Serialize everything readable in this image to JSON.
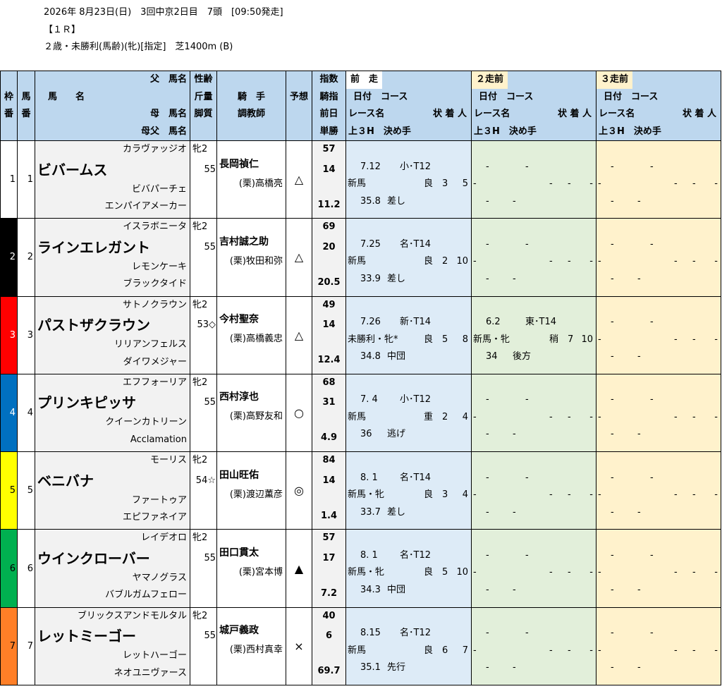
{
  "race": {
    "line1": "2026年 8月23日(日)　3回中京2日目　7頭　[09:50発走]",
    "line2": "【１Ｒ】",
    "line3": "２歳・未勝利(馬齢)(牝)[指定]　芝1400m (B)"
  },
  "header": {
    "waku": [
      "枠",
      "番"
    ],
    "uma": [
      "馬",
      "番"
    ],
    "name_col": [
      "父　馬名",
      "馬　　名",
      "母　馬名",
      "母父　馬名"
    ],
    "sei_col": [
      "性齢",
      "斤量",
      "脚質"
    ],
    "jockey_col": [
      "騎　手",
      "調教師"
    ],
    "yoso": "予想",
    "idx_col": [
      "指数",
      "騎指",
      "前日",
      "単勝"
    ],
    "prev1": {
      "title": "前　走",
      "date": "日付　コース",
      "race": "レース名",
      "stat": "状 着 人",
      "fin": "上３H　決め手"
    },
    "prev2": {
      "title": "２走前",
      "date": "日付　コース",
      "race": "レース名",
      "stat": "状 着 人",
      "fin": "上３H　決め手"
    },
    "prev3": {
      "title": "３走前",
      "date": "日付　コース",
      "race": "レース名",
      "stat": "状 着 人",
      "fin": "上３H　決め手"
    }
  },
  "colors": {
    "waku": [
      "#ffffff",
      "#000000",
      "#ff0000",
      "#0070c0",
      "#ffff00",
      "#00b050",
      "#ff7f27"
    ]
  },
  "horses": [
    {
      "waku": "1",
      "num": "1",
      "sire": "カラヴァッジオ",
      "name": "ビバームス",
      "dam": "ビバパーチェ",
      "damsire": "エンパイアメーカー",
      "sex": "牝2",
      "kinryo": "55",
      "jockey": "長岡禎仁",
      "trainer": "(栗)高橋亮",
      "yoso": "△",
      "idx": "57",
      "kishi": "14",
      "zenjitsu": "",
      "tansho": "11.2",
      "p1": {
        "date": "7.12",
        "course": "小･T12",
        "race": "新馬",
        "cond": "良",
        "place": "3",
        "pop": "5",
        "last3": "35.8",
        "kime": "差し"
      },
      "p2": {
        "date": "-",
        "course": "-",
        "race": "-",
        "cond": "-",
        "place": "-",
        "pop": "-",
        "last3": "-",
        "kime": "-"
      },
      "p3": {
        "date": "-",
        "course": "-",
        "race": "-",
        "cond": "-",
        "place": "-",
        "pop": "-",
        "last3": "-",
        "kime": "-"
      }
    },
    {
      "waku": "2",
      "num": "2",
      "sire": "イスラボニータ",
      "name": "ラインエレガント",
      "dam": "レモンケーキ",
      "damsire": "ブラックタイド",
      "sex": "牝2",
      "kinryo": "55",
      "jockey": "吉村誠之助",
      "trainer": "(栗)牧田和弥",
      "yoso": "△",
      "idx": "69",
      "kishi": "20",
      "zenjitsu": "",
      "tansho": "20.5",
      "p1": {
        "date": "7.25",
        "course": "名･T14",
        "race": "新馬",
        "cond": "良",
        "place": "2",
        "pop": "10",
        "last3": "33.9",
        "kime": "差し"
      },
      "p2": {
        "date": "-",
        "course": "-",
        "race": "-",
        "cond": "-",
        "place": "-",
        "pop": "-",
        "last3": "-",
        "kime": "-"
      },
      "p3": {
        "date": "-",
        "course": "-",
        "race": "-",
        "cond": "-",
        "place": "-",
        "pop": "-",
        "last3": "-",
        "kime": "-"
      }
    },
    {
      "waku": "3",
      "num": "3",
      "sire": "サトノクラウン",
      "name": "パストザクラウン",
      "dam": "リリアンフェルス",
      "damsire": "ダイワメジャー",
      "sex": "牝2",
      "kinryo": "53◇",
      "jockey": "今村聖奈",
      "trainer": "(栗)高橋義忠",
      "yoso": "△",
      "idx": "49",
      "kishi": "14",
      "zenjitsu": "",
      "tansho": "12.4",
      "p1": {
        "date": "7.26",
        "course": "新･T14",
        "race": "未勝利・牝*",
        "cond": "良",
        "place": "5",
        "pop": "8",
        "last3": "34.8",
        "kime": "中団"
      },
      "p2": {
        "date": "6.2",
        "course": "東･T14",
        "race": "新馬・牝",
        "cond": "稍",
        "place": "7",
        "pop": "10",
        "last3": "34",
        "kime": "後方"
      },
      "p3": {
        "date": "-",
        "course": "-",
        "race": "-",
        "cond": "-",
        "place": "-",
        "pop": "-",
        "last3": "-",
        "kime": "-"
      }
    },
    {
      "waku": "4",
      "num": "4",
      "sire": "エフフォーリア",
      "name": "プリンキピッサ",
      "dam": "クイーンカトリーン",
      "damsire": "Acclamation",
      "sex": "牝2",
      "kinryo": "55",
      "jockey": "西村淳也",
      "trainer": "(栗)高野友和",
      "yoso": "○",
      "idx": "68",
      "kishi": "31",
      "zenjitsu": "",
      "tansho": "4.9",
      "p1": {
        "date": "7. 4",
        "course": "小･T12",
        "race": "新馬",
        "cond": "重",
        "place": "2",
        "pop": "4",
        "last3": "36",
        "kime": "逃げ"
      },
      "p2": {
        "date": "-",
        "course": "-",
        "race": "-",
        "cond": "-",
        "place": "-",
        "pop": "-",
        "last3": "-",
        "kime": "-"
      },
      "p3": {
        "date": "-",
        "course": "-",
        "race": "-",
        "cond": "-",
        "place": "-",
        "pop": "-",
        "last3": "-",
        "kime": "-"
      }
    },
    {
      "waku": "5",
      "num": "5",
      "sire": "モーリス",
      "name": "ベニバナ",
      "dam": "ファートゥア",
      "damsire": "エピファネイア",
      "sex": "牝2",
      "kinryo": "54☆",
      "jockey": "田山旺佑",
      "trainer": "(栗)渡辺薫彦",
      "yoso": "◎",
      "idx": "84",
      "kishi": "14",
      "zenjitsu": "",
      "tansho": "1.4",
      "p1": {
        "date": "8. 1",
        "course": "名･T14",
        "race": "新馬・牝",
        "cond": "良",
        "place": "3",
        "pop": "4",
        "last3": "33.7",
        "kime": "差し"
      },
      "p2": {
        "date": "-",
        "course": "-",
        "race": "-",
        "cond": "-",
        "place": "-",
        "pop": "-",
        "last3": "-",
        "kime": "-"
      },
      "p3": {
        "date": "-",
        "course": "-",
        "race": "-",
        "cond": "-",
        "place": "-",
        "pop": "-",
        "last3": "-",
        "kime": "-"
      }
    },
    {
      "waku": "6",
      "num": "6",
      "sire": "レイデオロ",
      "name": "ウインクローバー",
      "dam": "ヤマノグラス",
      "damsire": "バブルガムフェロー",
      "sex": "牝2",
      "kinryo": "55",
      "jockey": "田口貫太",
      "trainer": "(栗)宮本博",
      "yoso": "▲",
      "idx": "57",
      "kishi": "17",
      "zenjitsu": "",
      "tansho": "7.2",
      "p1": {
        "date": "8. 1",
        "course": "名･T12",
        "race": "新馬・牝",
        "cond": "良",
        "place": "5",
        "pop": "10",
        "last3": "34.3",
        "kime": "中団"
      },
      "p2": {
        "date": "-",
        "course": "-",
        "race": "-",
        "cond": "-",
        "place": "-",
        "pop": "-",
        "last3": "-",
        "kime": "-"
      },
      "p3": {
        "date": "-",
        "course": "-",
        "race": "-",
        "cond": "-",
        "place": "-",
        "pop": "-",
        "last3": "-",
        "kime": "-"
      }
    },
    {
      "waku": "7",
      "num": "7",
      "sire": "ブリックスアンドモルタル",
      "name": "レットミーゴー",
      "dam": "レットハーゴー",
      "damsire": "ネオユニヴァース",
      "sex": "牝2",
      "kinryo": "55",
      "jockey": "城戸義政",
      "trainer": "(栗)西村真幸",
      "yoso": "×",
      "idx": "40",
      "kishi": "6",
      "zenjitsu": "",
      "tansho": "69.7",
      "p1": {
        "date": "8.15",
        "course": "名･T12",
        "race": "新馬",
        "cond": "良",
        "place": "6",
        "pop": "7",
        "last3": "35.1",
        "kime": "先行"
      },
      "p2": {
        "date": "-",
        "course": "-",
        "race": "-",
        "cond": "-",
        "place": "-",
        "pop": "-",
        "last3": "-",
        "kime": "-"
      },
      "p3": {
        "date": "-",
        "course": "-",
        "race": "-",
        "cond": "-",
        "place": "-",
        "pop": "-",
        "last3": "-",
        "kime": "-"
      }
    }
  ]
}
